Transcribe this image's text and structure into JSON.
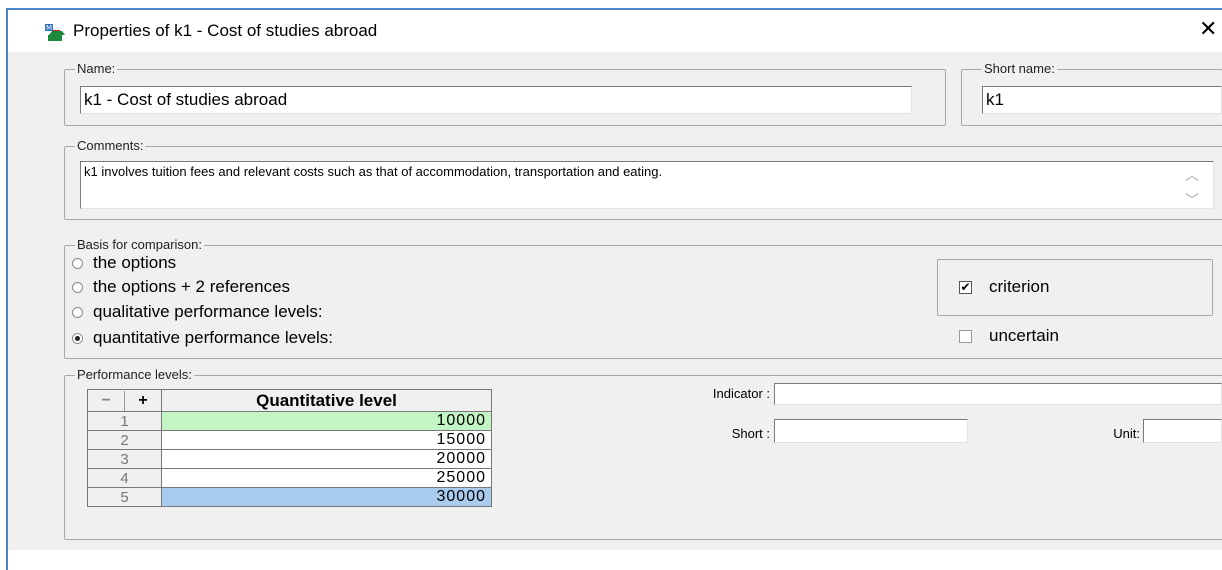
{
  "window": {
    "title": "Properties of  k1 - Cost of studies abroad",
    "close_glyph": "✕"
  },
  "name_group": {
    "legend": "Name:",
    "value": "k1 - Cost of studies abroad"
  },
  "short_name_group": {
    "legend": "Short name:",
    "value": "k1"
  },
  "comments_group": {
    "legend": "Comments:",
    "value": "k1 involves tuition fees and relevant costs such as that of accommodation, transportation and eating."
  },
  "basis_group": {
    "legend": "Basis for comparison:",
    "options": [
      {
        "label": "the options",
        "checked": false
      },
      {
        "label": "the options + 2 references",
        "checked": false
      },
      {
        "label": "qualitative performance levels:",
        "checked": false
      },
      {
        "label": "quantitative performance levels:",
        "checked": true
      }
    ],
    "criterion": {
      "label": "criterion",
      "checked": true
    },
    "uncertain": {
      "label": "uncertain",
      "checked": false
    }
  },
  "performance_group": {
    "legend": "Performance levels:",
    "grid": {
      "remove_label": "−",
      "add_label": "+",
      "column_header": "Quantitative level",
      "rows": [
        {
          "num": "1",
          "value": "10000",
          "highlight": "#c4f5c4"
        },
        {
          "num": "2",
          "value": "15000",
          "highlight": "#ffffff"
        },
        {
          "num": "3",
          "value": "20000",
          "highlight": "#ffffff"
        },
        {
          "num": "4",
          "value": "25000",
          "highlight": "#ffffff"
        },
        {
          "num": "5",
          "value": "30000",
          "highlight": "#a9cbee"
        }
      ]
    },
    "indicator_label": "Indicator :",
    "indicator_value": "",
    "short_label": "Short :",
    "short_value": "",
    "unit_label": "Unit:",
    "unit_value": ""
  }
}
